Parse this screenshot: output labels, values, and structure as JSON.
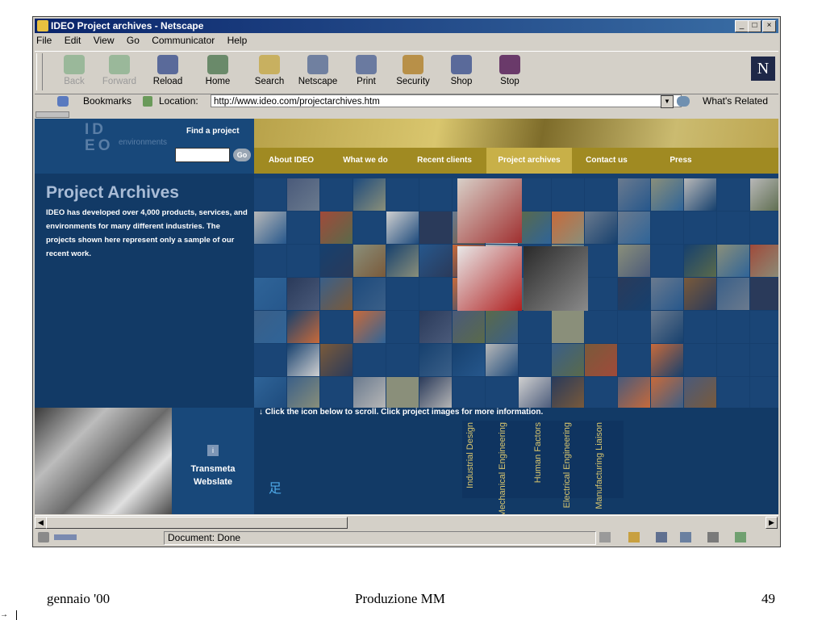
{
  "window": {
    "title": "IDEO Project archives - Netscape",
    "controls": [
      "_",
      "□",
      "×"
    ]
  },
  "menu": [
    "File",
    "Edit",
    "View",
    "Go",
    "Communicator",
    "Help"
  ],
  "toolbar": [
    {
      "label": "Back",
      "icon": "back-arrow-icon",
      "enabled": false
    },
    {
      "label": "Forward",
      "icon": "forward-arrow-icon",
      "enabled": false
    },
    {
      "label": "Reload",
      "icon": "reload-icon",
      "enabled": true
    },
    {
      "label": "Home",
      "icon": "home-icon",
      "enabled": true
    },
    {
      "label": "Search",
      "icon": "search-icon",
      "enabled": true
    },
    {
      "label": "Netscape",
      "icon": "netscape-icon",
      "enabled": true
    },
    {
      "label": "Print",
      "icon": "print-icon",
      "enabled": true
    },
    {
      "label": "Security",
      "icon": "lock-icon",
      "enabled": true
    },
    {
      "label": "Shop",
      "icon": "shop-icon",
      "enabled": true
    },
    {
      "label": "Stop",
      "icon": "stop-icon",
      "enabled": true
    }
  ],
  "location": {
    "bookmarks_label": "Bookmarks",
    "location_label": "Location:",
    "url": "http://www.ideo.com/projectarchives.htm",
    "whats_related": "What's Related"
  },
  "site": {
    "logo_letters": [
      "I",
      "D",
      "E",
      "O"
    ],
    "logo_sub": "environments",
    "find_label": "Find a project",
    "go_label": "Go",
    "nav": [
      "About IDEO",
      "What we do",
      "Recent clients",
      "Project archives",
      "Contact us",
      "Press"
    ],
    "selected_nav": "Project archives",
    "page_title": "Project Archives",
    "description": "IDEO has developed over 4,000 products, services, and environments for many different industries.  The projects shown here represent only a sample of our recent work.",
    "scroll_hint": "↓ Click the icon below to scroll.  Click project images for more information.",
    "info_icon": "i",
    "product_name": "Transmeta Webslate",
    "disciplines": [
      "Industrial Design",
      "Mechanical Engineering",
      "Human Factors",
      "Electrical Engineering",
      "Manufacturing Liaison"
    ]
  },
  "status": {
    "text": "Document: Done"
  },
  "slide_footer": {
    "left": "gennaio '00",
    "center": "Produzione MM",
    "right": "49"
  },
  "colors": {
    "page_bg": "#123a66",
    "nav_bg": "#a08a22",
    "accent_gold": "#d9c66e"
  }
}
